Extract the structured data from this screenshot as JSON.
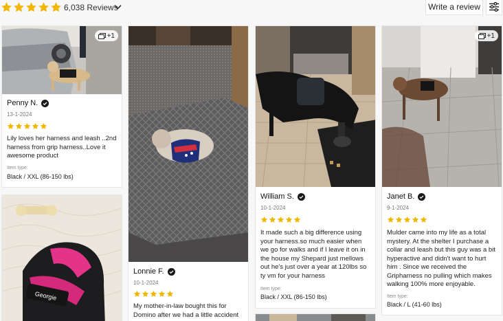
{
  "header": {
    "rating_stars": 5,
    "review_count": "6,038 Reviews",
    "write_review": "Write a review",
    "icons": {
      "sort": "chevron-down-icon",
      "filter": "sliders-icon"
    }
  },
  "colors": {
    "star": "#f2b705",
    "badge_check": "#1a1a1a"
  },
  "reviews": [
    {
      "name": "Penny N.",
      "date": "13-1-2024",
      "stars": 5,
      "text": "Lily loves her harness and leash ..2nd harness from grip harness..Love it awesome product",
      "item_type_label": "Item type:",
      "item_type": "Black / XXL (86-150 lbs)",
      "photo_badge": "+1",
      "photo_alt": "Yellow dog in black harness next to a silver car"
    },
    {
      "name": "Lonnie F.",
      "date": "10-1-2024",
      "stars": 5,
      "text": "My mother-in-law bought this for Domino after we had a little accident",
      "photo_alt": "Small dog in patriotic harness lying on a dog bed"
    },
    {
      "name": "William S.",
      "date": "10-1-2024",
      "stars": 5,
      "text": "It made such a big difference using your harness.so much easier when we go for walks and if I leave it on in the house my Shepard just mellows out he's just over a year at 120lbs so ty vm for your harness",
      "item_type_label": "Item type:",
      "item_type": "Black / XXL (86-150 lbs)",
      "photo_alt": "Black shepherd dog in harness in a kitchen"
    },
    {
      "name": "Janet B.",
      "date": "9-1-2024",
      "stars": 5,
      "text": "Mulder came into my life as a total mystery. At the shelter I purchase a collar and leash but this guy was a bit hyperactive and didn't want to hurt him . Since we received the Gripharness no pulling which makes walking 100% more enjoyable.",
      "item_type_label": "Item type:",
      "item_type": "Black / L (41-60 lbs)",
      "photo_badge": "+1",
      "photo_alt": "Brindle dog in harness standing on tile floor"
    },
    {
      "photo_alt": "Pink harness with Georgie patch on a mattress"
    }
  ]
}
